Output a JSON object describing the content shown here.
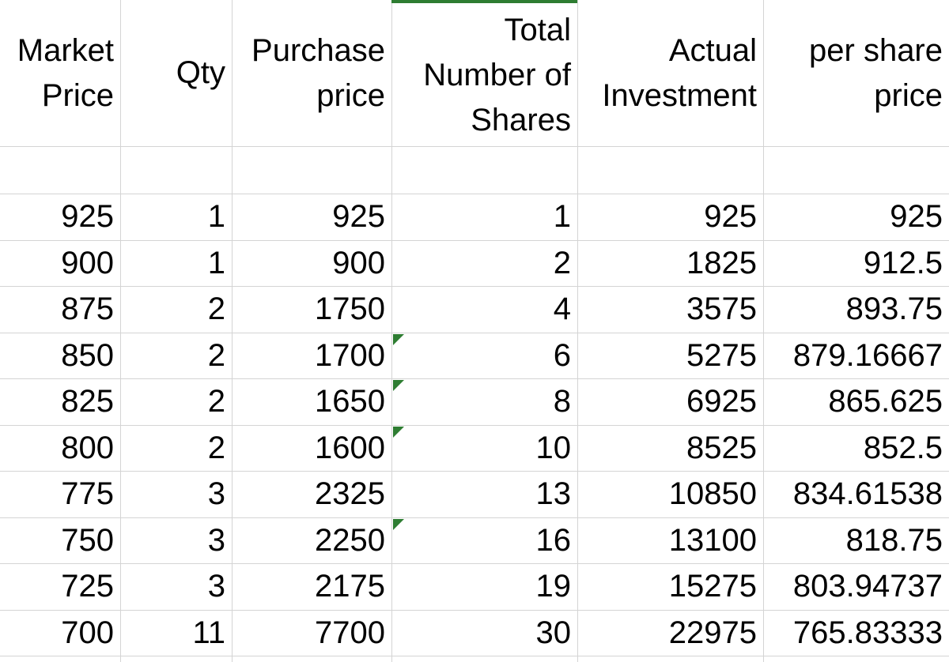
{
  "sheet": {
    "accent_color": "#2e7d32",
    "grid_color": "#d4d4d4",
    "headers": [
      "Market\nPrice",
      "Qty",
      "Purchase\nprice",
      "Total\nNumber of\nShares",
      "Actual\nInvestment",
      "per share\nprice"
    ],
    "rows": [
      [
        "925",
        "1",
        "925",
        "1",
        "925",
        "925"
      ],
      [
        "900",
        "1",
        "900",
        "2",
        "1825",
        "912.5"
      ],
      [
        "875",
        "2",
        "1750",
        "4",
        "3575",
        "893.75"
      ],
      [
        "850",
        "2",
        "1700",
        "6",
        "5275",
        "879.16667"
      ],
      [
        "825",
        "2",
        "1650",
        "8",
        "6925",
        "865.625"
      ],
      [
        "800",
        "2",
        "1600",
        "10",
        "8525",
        "852.5"
      ],
      [
        "775",
        "3",
        "2325",
        "13",
        "10850",
        "834.61538"
      ],
      [
        "750",
        "3",
        "2250",
        "16",
        "13100",
        "818.75"
      ],
      [
        "725",
        "3",
        "2175",
        "19",
        "15275",
        "803.94737"
      ],
      [
        "700",
        "11",
        "7700",
        "30",
        "22975",
        "765.83333"
      ]
    ],
    "error_indicator_rows": [
      3,
      4,
      5,
      7
    ]
  }
}
